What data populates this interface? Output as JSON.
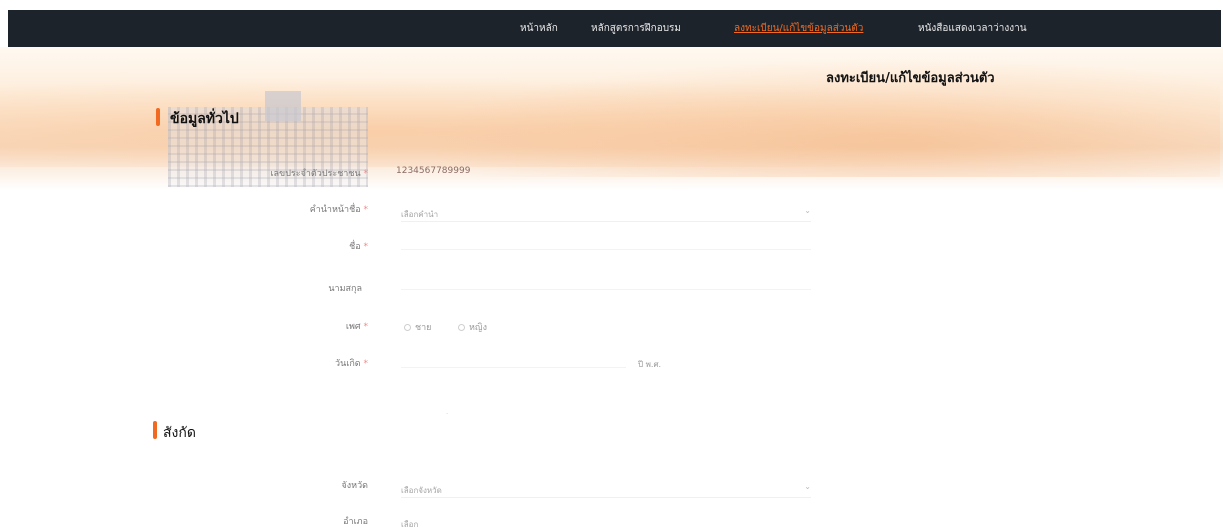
{
  "nav": {
    "items": [
      {
        "label": "หน้าหลัก"
      },
      {
        "label": "หลักสูตรการฝึกอบรม"
      },
      {
        "label": "ลงทะเบียน/แก้ไขข้อมูลส่วนตัว"
      },
      {
        "label": "หนังสือแสดงเวลาว่างงาน"
      }
    ],
    "active_index": 2,
    "background": "#1d232b",
    "accent": "#f26a21"
  },
  "page": {
    "title": "ลงทะเบียน/แก้ไขข้อมูลส่วนตัว"
  },
  "section_general": {
    "title": "ข้อมูลทั่วไป",
    "fields": {
      "id_number": {
        "label": "เลขประจำตัวประชาชน",
        "value": "1234567789999"
      },
      "prefix": {
        "label": "คำนำหน้าชื่อ",
        "placeholder": "เลือกคำนำ"
      },
      "first_name": {
        "label": "ชื่อ"
      },
      "last_name": {
        "label": "นามสกุล"
      },
      "gender": {
        "label": "เพศ",
        "options": [
          "ชาย",
          "หญิง"
        ]
      },
      "birthdate": {
        "label": "วันเกิด",
        "extra": "ปี พ.ศ."
      }
    }
  },
  "section_affiliation": {
    "title": "สังกัด",
    "fields": {
      "province": {
        "label": "จังหวัด",
        "placeholder": "เลือกจังหวัด"
      },
      "district": {
        "label": "อำเภอ",
        "placeholder": "เลือก"
      }
    }
  }
}
